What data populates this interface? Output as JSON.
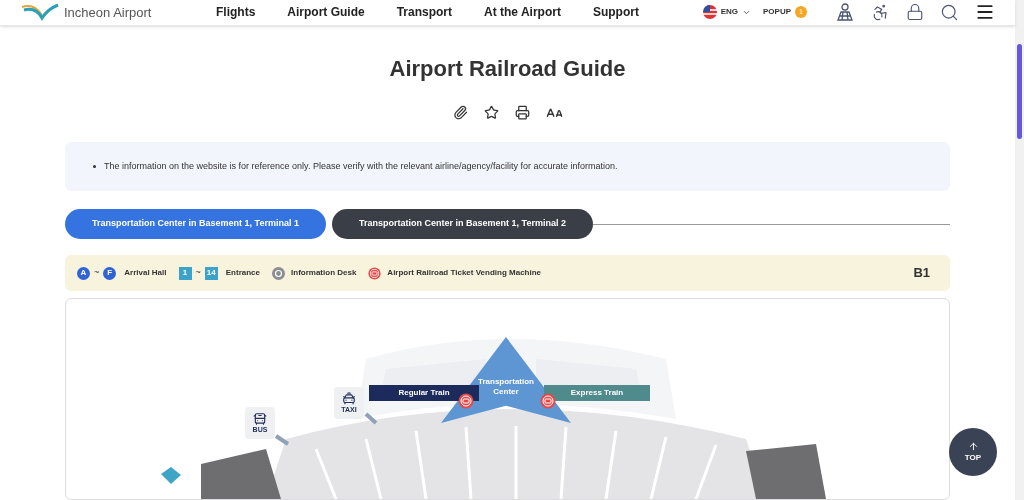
{
  "header": {
    "logo_text": "Incheon Airport",
    "nav": [
      "Flights",
      "Airport Guide",
      "Transport",
      "At the Airport",
      "Support"
    ],
    "language": "ENG",
    "popup": {
      "label": "POPUP",
      "count": "1"
    }
  },
  "page": {
    "title": "Airport Railroad Guide"
  },
  "notice": [
    "The information on the website is for reference only. Please verify with the relevant airline/agency/facility for accurate information."
  ],
  "tabs": [
    {
      "label": "Transportation Center in Basement 1, Terminal 1",
      "selected": true
    },
    {
      "label": "Transportation Center in Basement 1, Terminal 2",
      "selected": false
    }
  ],
  "legend": {
    "items": [
      {
        "kind": "circle-range",
        "from": "A",
        "separator": "~",
        "to": "F",
        "label": "Arrival Hall"
      },
      {
        "kind": "square-range",
        "from": "1",
        "separator": "~",
        "to": "14",
        "label": "Entrance"
      },
      {
        "kind": "info",
        "label": "Information Desk"
      },
      {
        "kind": "vending",
        "label": "Airport Railroad Ticket Vending Machine"
      }
    ],
    "floor": "B1"
  },
  "map": {
    "center": "Transportation Center",
    "lines": [
      {
        "kind": "regular",
        "label": "Regular Train"
      },
      {
        "kind": "express",
        "label": "Express Train"
      }
    ],
    "transit": [
      {
        "kind": "taxi",
        "label": "TAXI"
      },
      {
        "kind": "bus",
        "label": "BUS"
      }
    ]
  },
  "top_button": "TOP"
}
